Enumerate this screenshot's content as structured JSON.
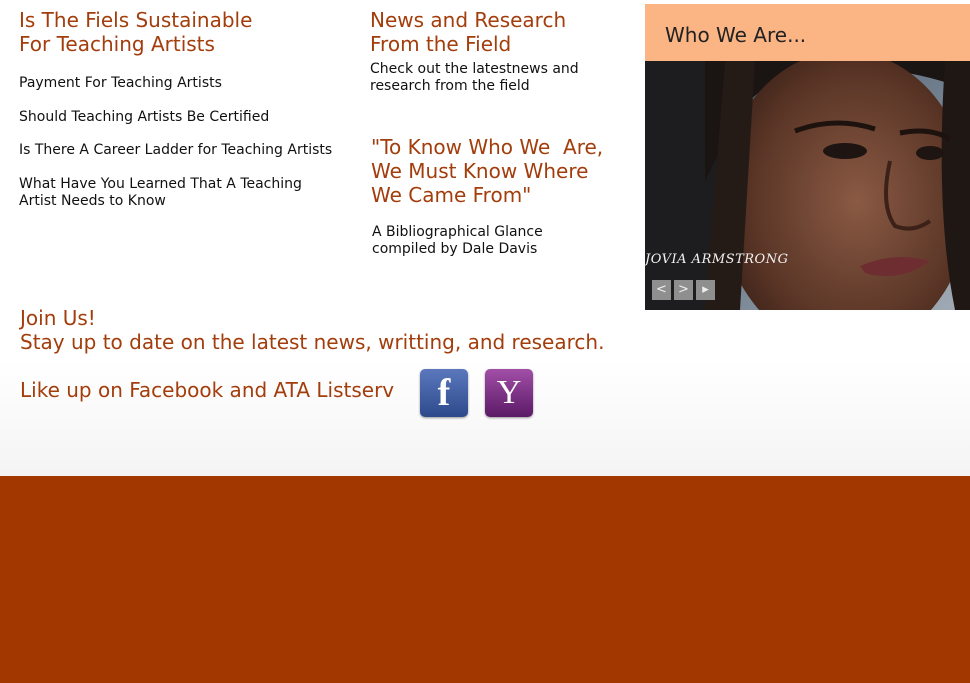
{
  "col1": {
    "heading_line1": "Is The Fiels Sustainable",
    "heading_line2": "For Teaching Artists",
    "links": [
      "Payment For Teaching Artists",
      "Should Teaching Artists Be Certified",
      "Is There A Career Ladder for Teaching Artists",
      "What Have You Learned That A Teaching",
      "Artist Needs to Know"
    ]
  },
  "col2": {
    "heading_line1": "News and Research",
    "heading_line2": "From the Field",
    "intro_line1": "Check out the latestnews and",
    "intro_line2": "research from the field",
    "quote_line1": "\"To Know Who We  Are,",
    "quote_line2": "We Must Know Where",
    "quote_line3": "We Came From\"",
    "biblio_line1": "A Bibliographical Glance",
    "biblio_line2": "compiled by Dale Davis"
  },
  "panel": {
    "title": "Who We Are...",
    "caption": "JOVIA ARMSTRONG",
    "prev": "<",
    "next": ">",
    "play": "▸"
  },
  "join": {
    "title": "Join Us!",
    "subtitle": "Stay up to date on the latest news, writting, and research.",
    "like_text": "Like up on Facebook and ATA Listserv",
    "facebook_icon": "facebook-icon",
    "facebook_glyph": "f",
    "yahoo_icon": "yahoo-icon",
    "yahoo_glyph": "Y"
  },
  "colors": {
    "accent": "#a33d0c",
    "footer": "#a33700",
    "panel_header": "#fbb584"
  }
}
